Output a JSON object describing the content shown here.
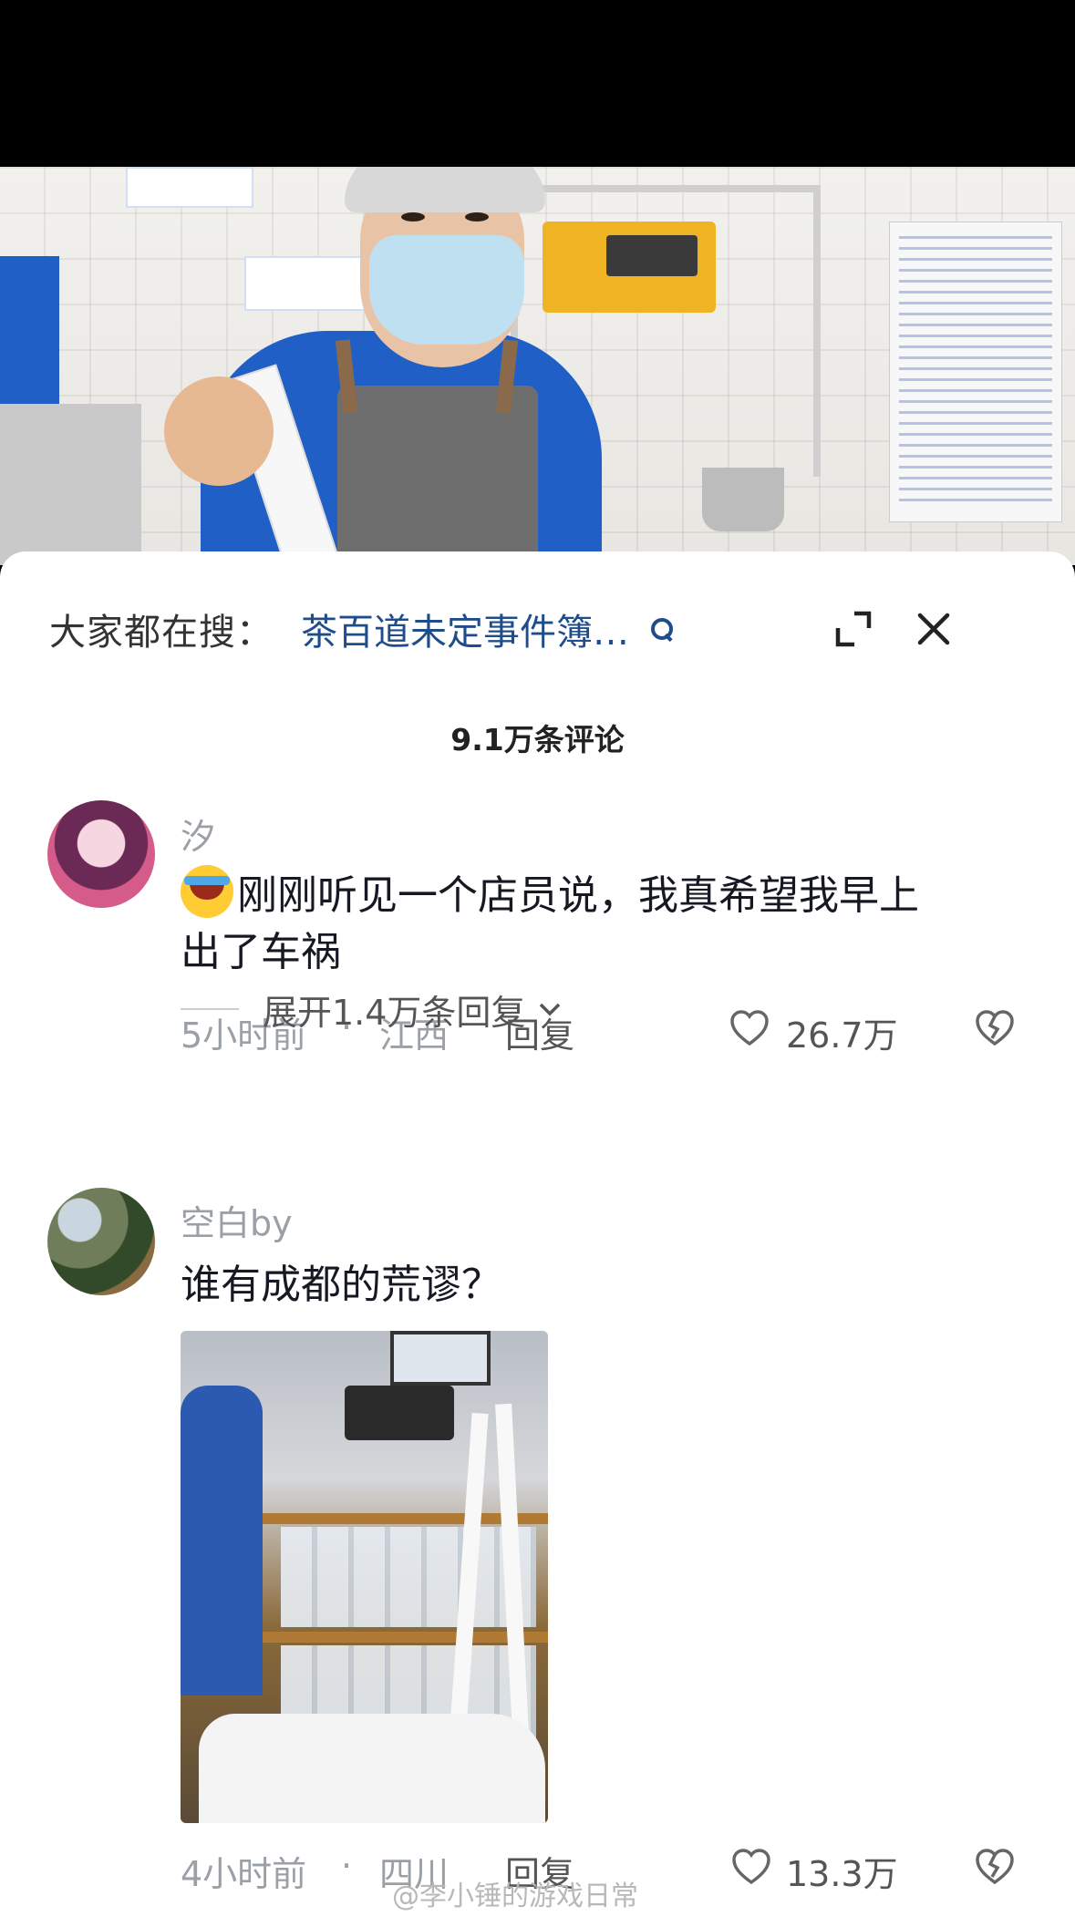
{
  "search": {
    "prefix": "大家都在搜：",
    "term": "茶百道未定事件簿…"
  },
  "comments_header": {
    "count_label": "9.1万条评论"
  },
  "comments": [
    {
      "username": "汐",
      "text": "刚刚听见一个店员说，我真希望我早上出了车祸",
      "text_line1": "刚刚听见一个店员说，我真希望我早上",
      "text_line2": "出了车祸",
      "time": "5小时前",
      "location": "江西",
      "reply_label": "回复",
      "likes": "26.7万",
      "expand_label": "展开1.4万条回复"
    },
    {
      "username": "空白by",
      "text": "谁有成都的荒谬？",
      "time": "4小时前",
      "location": "四川",
      "reply_label": "回复",
      "likes": "13.3万"
    }
  ],
  "meta_dot": "·",
  "watermark": "@李小锤的游戏日常",
  "colors": {
    "accent_link": "#1f4d8a",
    "secondary_text": "#9aa0a6"
  },
  "icons": [
    "search-icon",
    "expand-icon",
    "close-icon",
    "heart-icon",
    "broken-heart-icon",
    "chevron-down-icon"
  ]
}
